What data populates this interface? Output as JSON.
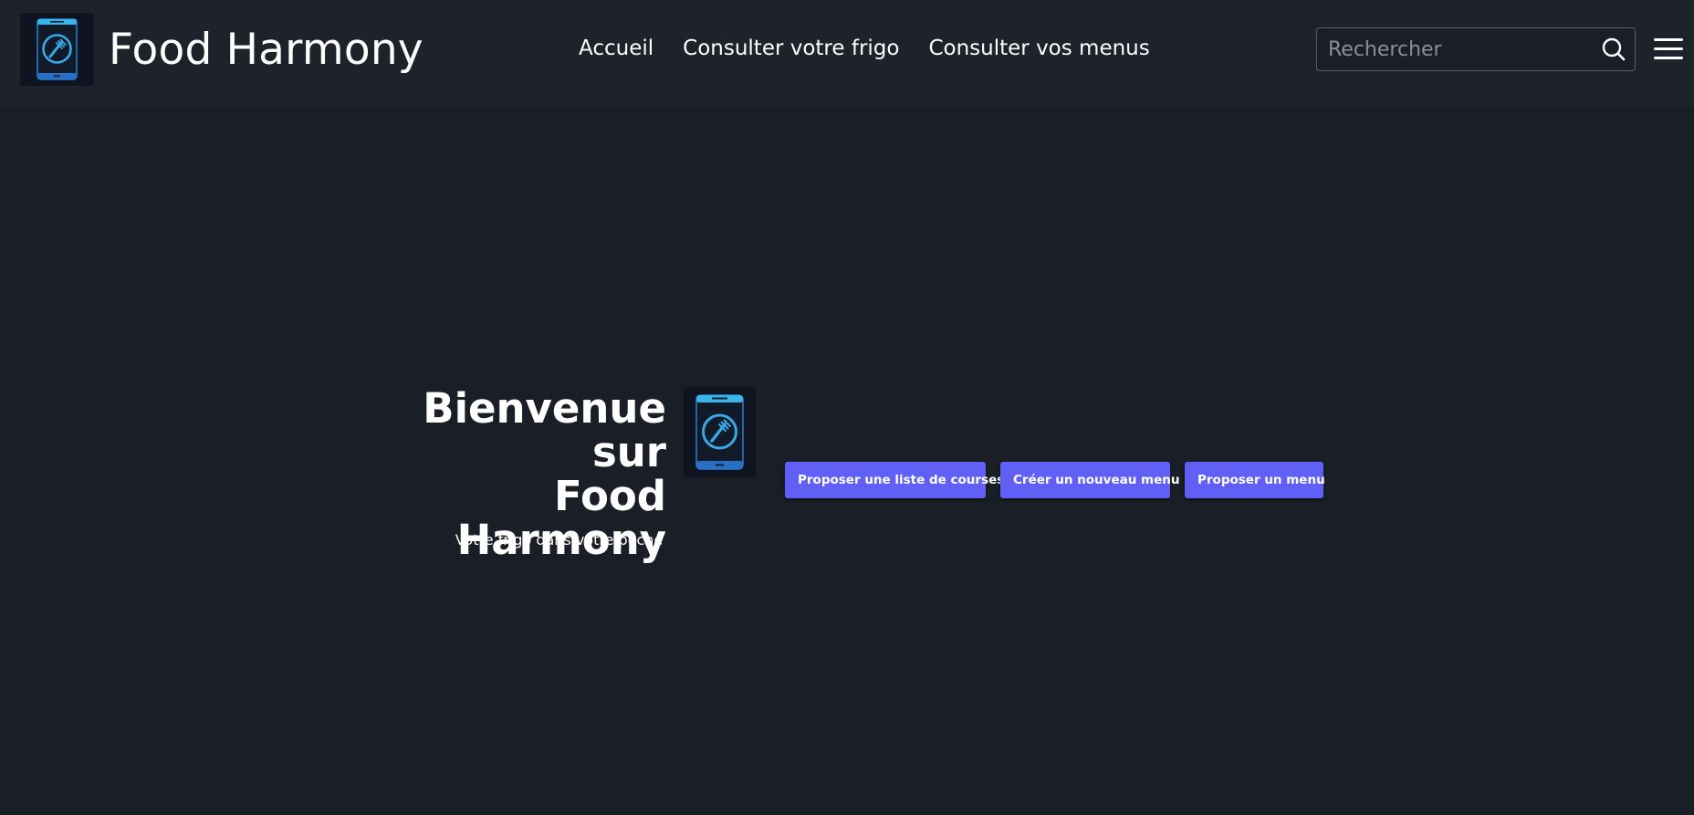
{
  "header": {
    "brand_name": "Food Harmony",
    "logo_icon": "phone-fork-logo-icon",
    "nav": [
      {
        "label": "Accueil"
      },
      {
        "label": "Consulter votre frigo"
      },
      {
        "label": "Consulter vos menus"
      }
    ],
    "search": {
      "placeholder": "Rechercher",
      "value": "",
      "icon": "search-icon"
    },
    "menu_icon": "hamburger-menu-icon"
  },
  "hero": {
    "title_line1": "Bienvenue sur",
    "title_line2": "Food Harmony",
    "tagline": "Votre frigo dans votre poche",
    "logo_icon": "phone-fork-logo-icon"
  },
  "actions": [
    {
      "label": "Proposer une liste de courses"
    },
    {
      "label": "Créer un nouveau menu"
    },
    {
      "label": "Proposer un menu"
    }
  ],
  "colors": {
    "background": "#1a1e26",
    "navbar": "#1e232b",
    "button": "#6060f7",
    "logo_blue": "#3aa8e6",
    "logo_bg": "#0e1520"
  }
}
